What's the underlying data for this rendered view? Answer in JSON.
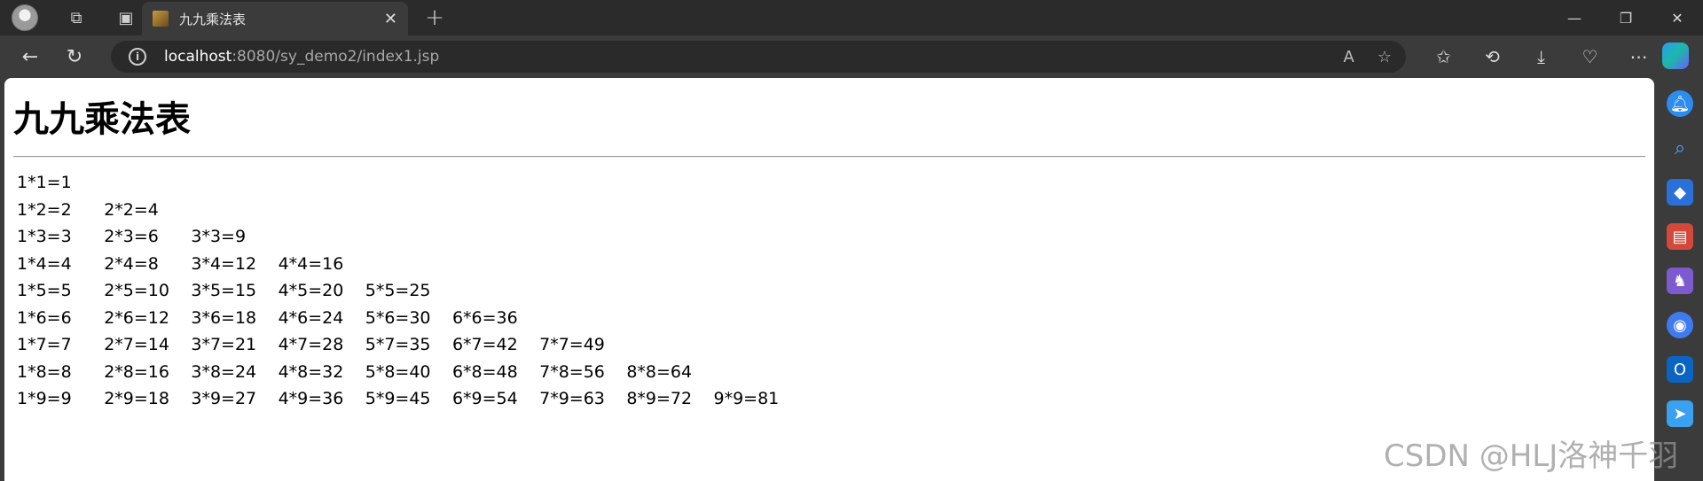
{
  "browser": {
    "tab": {
      "title": "九九乘法表",
      "close": "✕"
    },
    "new_tab": "+",
    "window_controls": {
      "minimize": "—",
      "restore": "❐",
      "close": "✕"
    },
    "address": {
      "host": "localhost",
      "path": ":8080/sy_demo2/index1.jsp"
    },
    "toolbar_icons": [
      "read-aloud-icon",
      "favorite-star-icon",
      "favorites-icon",
      "history-icon",
      "downloads-icon",
      "browser-essentials-icon",
      "more-icon"
    ],
    "sidebar_icons": [
      "notification-icon",
      "search-icon",
      "shopping-icon",
      "tools-icon",
      "games-icon",
      "microsoft365-icon",
      "outlook-icon",
      "send-icon"
    ]
  },
  "page": {
    "heading": "九九乘法表",
    "table": [
      [
        "1*1=1"
      ],
      [
        "1*2=2",
        "2*2=4"
      ],
      [
        "1*3=3",
        "2*3=6",
        "3*3=9"
      ],
      [
        "1*4=4",
        "2*4=8",
        "3*4=12",
        "4*4=16"
      ],
      [
        "1*5=5",
        "2*5=10",
        "3*5=15",
        "4*5=20",
        "5*5=25"
      ],
      [
        "1*6=6",
        "2*6=12",
        "3*6=18",
        "4*6=24",
        "5*6=30",
        "6*6=36"
      ],
      [
        "1*7=7",
        "2*7=14",
        "3*7=21",
        "4*7=28",
        "5*7=35",
        "6*7=42",
        "7*7=49"
      ],
      [
        "1*8=8",
        "2*8=16",
        "3*8=24",
        "4*8=32",
        "5*8=40",
        "6*8=48",
        "7*8=56",
        "8*8=64"
      ],
      [
        "1*9=9",
        "2*9=18",
        "3*9=27",
        "4*9=36",
        "5*9=45",
        "6*9=54",
        "7*9=63",
        "8*9=72",
        "9*9=81"
      ]
    ]
  },
  "watermark": "CSDN @HLJ洛神千羽"
}
